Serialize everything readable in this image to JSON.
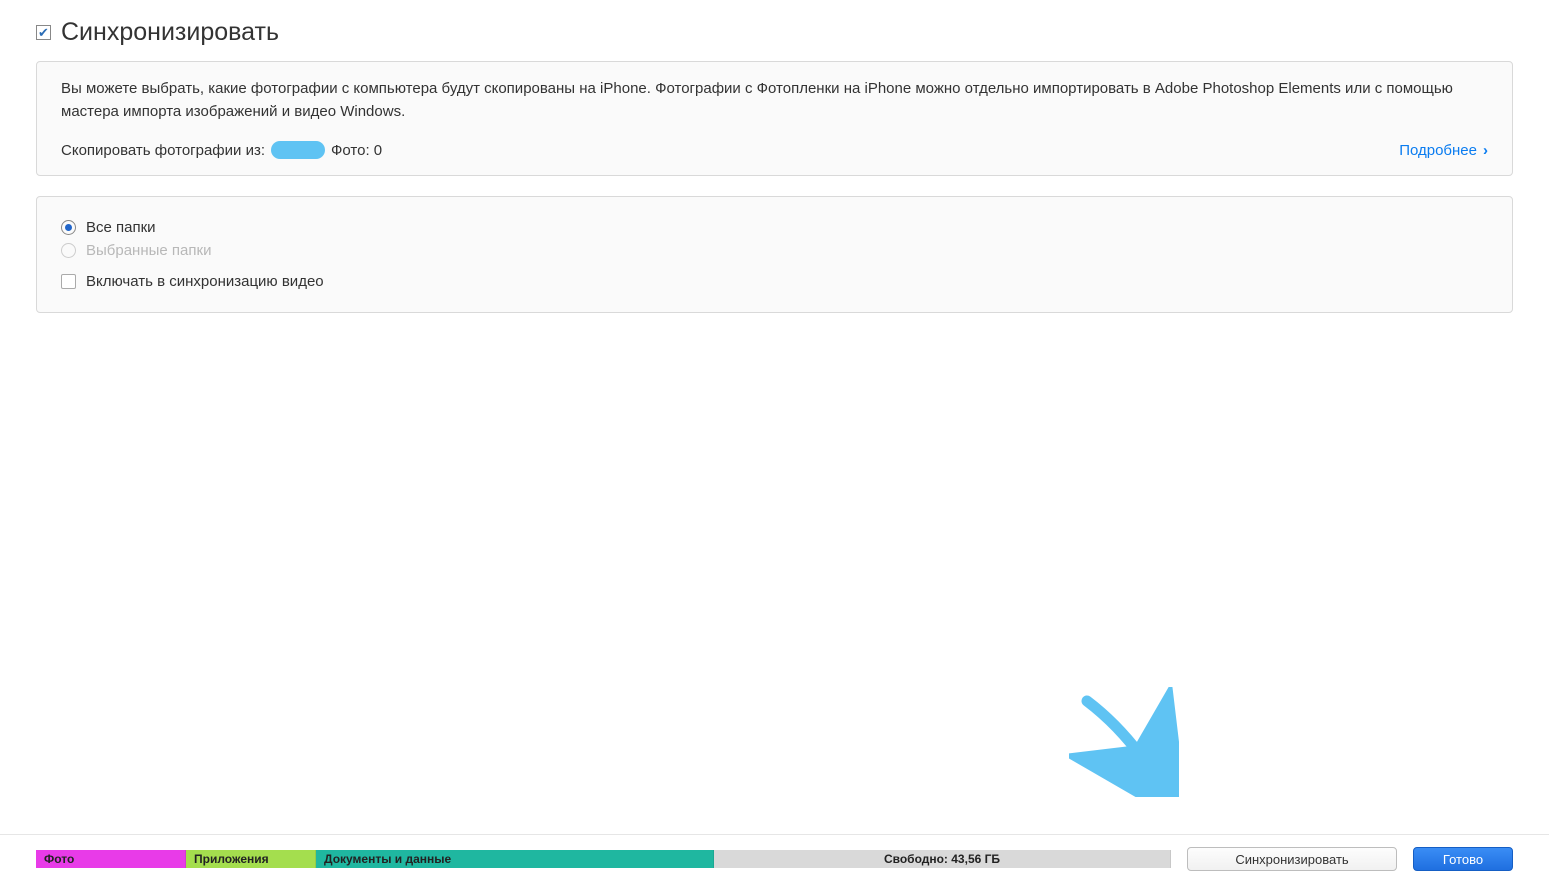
{
  "header": {
    "checkbox_checked": true,
    "title": "Синхронизировать"
  },
  "info": {
    "description": "Вы можете выбрать, какие фотографии с компьютера будут скопированы на iPhone. Фотографии с Фотопленки на iPhone можно отдельно импортировать в Adobe Photoshop Elements или с помощью мастера импорта изображений и видео Windows.",
    "copy_from_label": "Скопировать фотографии из:",
    "photos_count_label": "Фото: 0",
    "learn_more": "Подробнее"
  },
  "options": {
    "radio_all": "Все папки",
    "radio_selected": "Выбранные папки",
    "include_video": "Включать в синхронизацию видео"
  },
  "storage": {
    "segments": {
      "photo": "Фото",
      "apps": "Приложения",
      "docs": "Документы и данные"
    },
    "free_label": "Свободно: 43,56 ГБ"
  },
  "buttons": {
    "sync": "Синхронизировать",
    "done": "Готово"
  }
}
